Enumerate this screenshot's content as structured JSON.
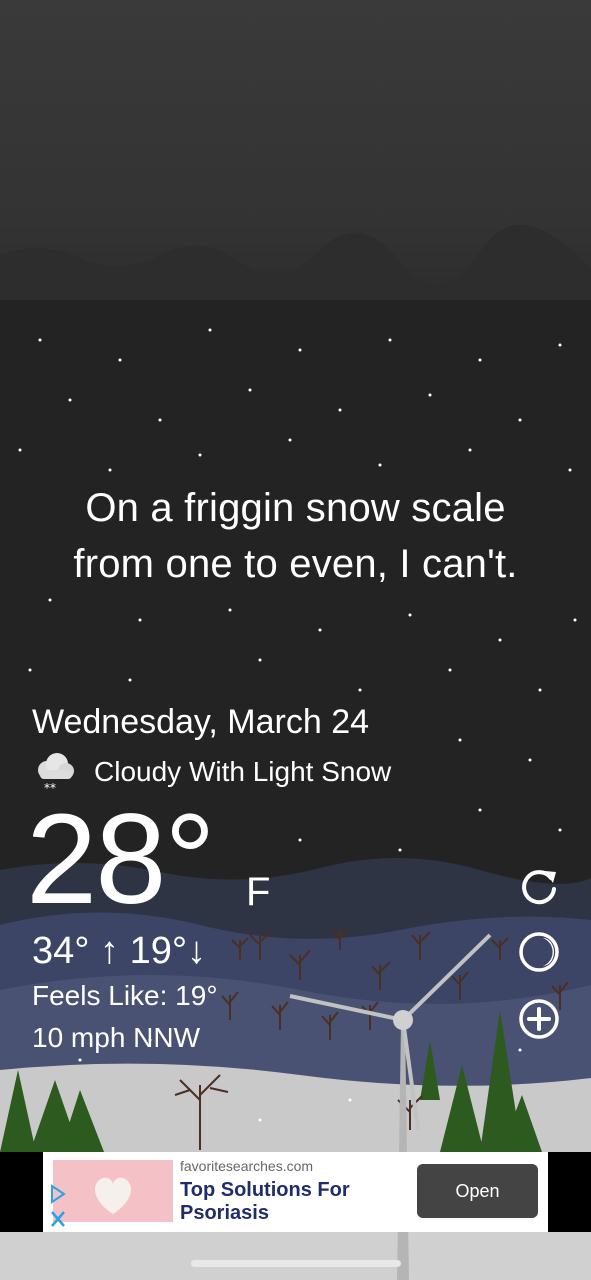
{
  "quote": {
    "line1": "On a friggin snow scale",
    "line2": "from one to even, I can't."
  },
  "weather": {
    "date": "Wednesday, March 24",
    "condition": "Cloudy With Light Snow",
    "condition_icon": "cloud-snow-icon",
    "temperature": "28°",
    "unit": "F",
    "high": "34°",
    "low": "19°",
    "feels_like": "Feels Like: 19°",
    "wind": "10 mph NNW"
  },
  "controls": {
    "refresh_icon": "refresh-icon",
    "theme_icon": "moon-icon",
    "add_icon": "add-icon"
  },
  "ad": {
    "domain": "favoritesearches.com",
    "title": "Top Solutions For Psoriasis",
    "button": "Open",
    "adchoices_icon": "adchoices-icon",
    "close_icon": "close-icon"
  },
  "colors": {
    "sky": "#232323",
    "hills_back": "#2f3444",
    "hills_mid": "#3d4566",
    "snow_ground": "#c9c9c9",
    "ad_button": "#444444",
    "ad_title": "#1f2d6b"
  }
}
